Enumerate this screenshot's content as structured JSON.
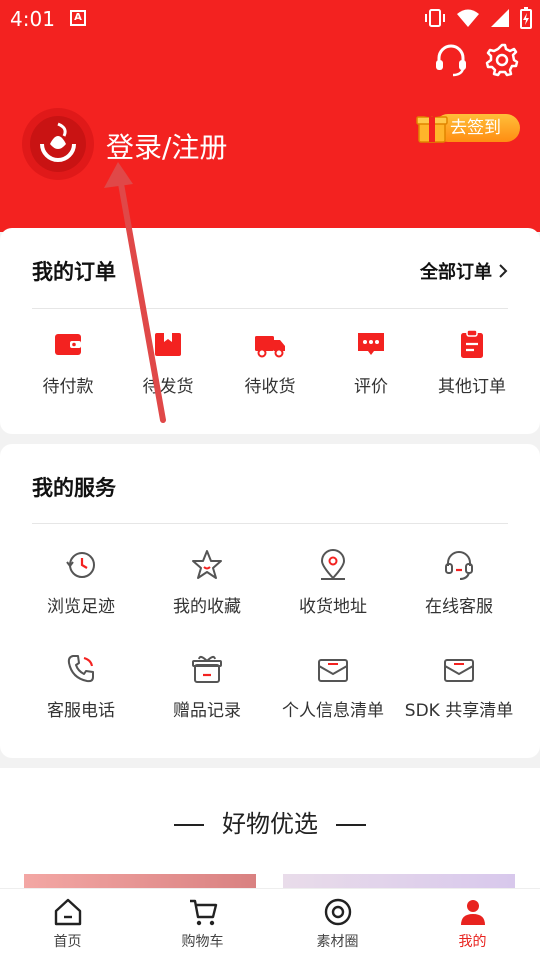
{
  "status_bar": {
    "time": "4:01",
    "a_badge": "A"
  },
  "header": {
    "login_label": "登录/注册",
    "checkin_label": "去签到",
    "icons": [
      "headset-icon",
      "gear-icon"
    ]
  },
  "orders": {
    "title": "我的订单",
    "all_label": "全部订单",
    "items": [
      {
        "label": "待付款",
        "icon": "wallet-icon"
      },
      {
        "label": "待发货",
        "icon": "package-icon"
      },
      {
        "label": "待收货",
        "icon": "truck-icon"
      },
      {
        "label": "评价",
        "icon": "comment-icon"
      },
      {
        "label": "其他订单",
        "icon": "clipboard-icon"
      }
    ]
  },
  "services": {
    "title": "我的服务",
    "items": [
      {
        "label": "浏览足迹",
        "icon": "history-icon"
      },
      {
        "label": "我的收藏",
        "icon": "star-icon"
      },
      {
        "label": "收货地址",
        "icon": "location-icon"
      },
      {
        "label": "在线客服",
        "icon": "headset-icon"
      },
      {
        "label": "客服电话",
        "icon": "phone-icon"
      },
      {
        "label": "赠品记录",
        "icon": "gift-icon"
      },
      {
        "label": "个人信息清单",
        "icon": "mail-list-icon"
      },
      {
        "label": "SDK 共享清单",
        "icon": "mail-list-icon"
      }
    ]
  },
  "picks": {
    "title": "好物优选"
  },
  "bottom_nav": {
    "items": [
      {
        "label": "首页",
        "icon": "home-icon"
      },
      {
        "label": "购物车",
        "icon": "cart-icon"
      },
      {
        "label": "素材圈",
        "icon": "circle-icon"
      },
      {
        "label": "我的",
        "icon": "user-icon",
        "active": true
      }
    ]
  },
  "colors": {
    "brand_red": "#f32220",
    "accent_red": "#e8231f",
    "gold": "#ff9d1f"
  }
}
